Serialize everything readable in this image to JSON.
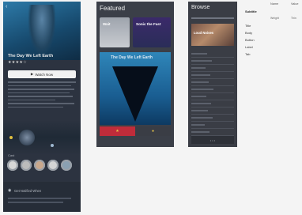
{
  "detail": {
    "movie_title": "The Day We Left Earth",
    "rating_stars": "★★★★☆",
    "watch_label": "Watch Now",
    "section_label": "Cast",
    "bottom_label": "Get Notified When"
  },
  "featured": {
    "header": "Featured",
    "card1_title": "Wait",
    "card2_title": "Sonic the Fast",
    "hero_title": "The Day We Left Earth"
  },
  "browse": {
    "header": "Browse",
    "banner_title": "Loud Noises"
  },
  "panel": {
    "header_left": "Name",
    "header_right": "Value",
    "property_name": "Subtitle",
    "weight_label": "Weight",
    "weight_value": "Thin",
    "options": [
      "Title",
      "Body",
      "Button",
      "Label",
      "Tab"
    ]
  },
  "colors": {
    "phone_bg": "#2c3340",
    "accent_red": "#c02c3a",
    "hero_blue": "#2f86b9"
  }
}
